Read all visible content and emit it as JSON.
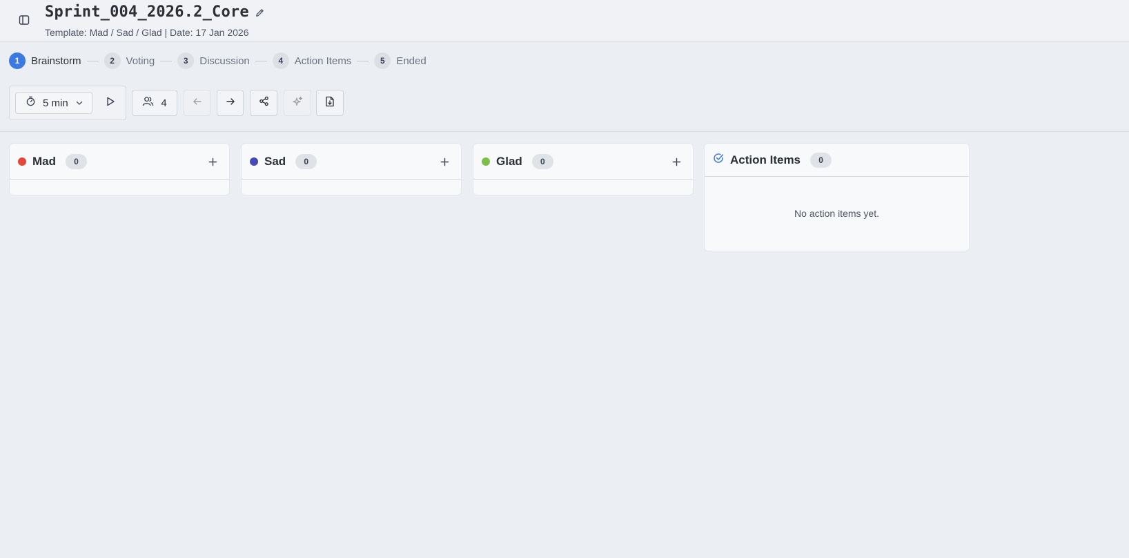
{
  "header": {
    "title": "Sprint_004_2026.2_Core",
    "subtitle": "Template: Mad / Sad / Glad | Date: 17 Jan 2026"
  },
  "steps": [
    {
      "num": "1",
      "label": "Brainstorm",
      "active": true
    },
    {
      "num": "2",
      "label": "Voting",
      "active": false
    },
    {
      "num": "3",
      "label": "Discussion",
      "active": false
    },
    {
      "num": "4",
      "label": "Action Items",
      "active": false
    },
    {
      "num": "5",
      "label": "Ended",
      "active": false
    }
  ],
  "toolbar": {
    "timer_value": "5 min",
    "participants_count": "4",
    "icons": [
      "stopwatch-icon",
      "chevron-down-icon",
      "play-icon",
      "users-icon",
      "arrow-left-icon",
      "arrow-right-icon",
      "share-icon",
      "sparkles-icon",
      "file-export-icon"
    ]
  },
  "columns": [
    {
      "title": "Mad",
      "count": "0",
      "color": "#e5483b"
    },
    {
      "title": "Sad",
      "count": "0",
      "color": "#4549b3"
    },
    {
      "title": "Glad",
      "count": "0",
      "color": "#7cc04a"
    }
  ],
  "action_items": {
    "title": "Action Items",
    "count": "0",
    "empty_text": "No action items yet.",
    "accent": "#3b7ae0"
  }
}
